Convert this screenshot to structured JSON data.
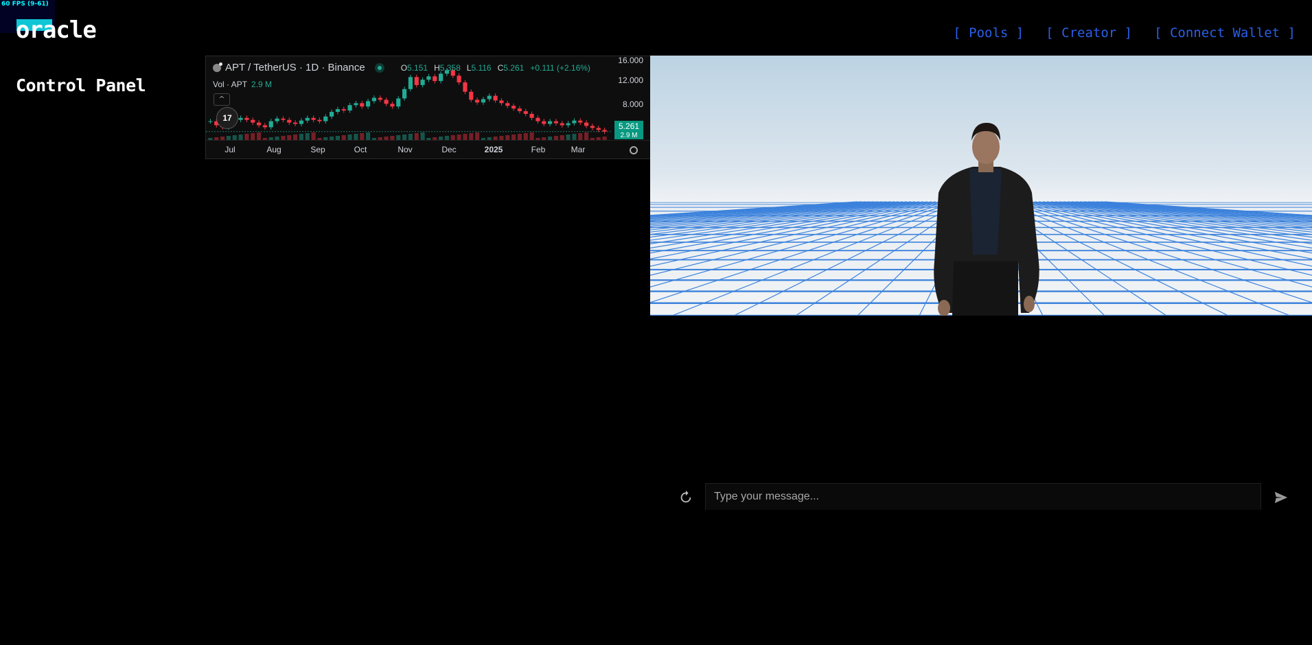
{
  "fps": {
    "label": "60 FPS (9-61)"
  },
  "header": {
    "logo": "oracle",
    "subtitle": "Control Panel",
    "nav": [
      "[ Pools ]",
      "[ Creator ]",
      "[ Connect Wallet ]"
    ]
  },
  "widget": {
    "symbol": "APT / TetherUS · 1D · Binance",
    "ohlc": [
      {
        "k": "O",
        "v": "5.151"
      },
      {
        "k": "H",
        "v": "5.358"
      },
      {
        "k": "L",
        "v": "5.116"
      },
      {
        "k": "C",
        "v": "5.261"
      }
    ],
    "change": "+0.111 (+2.16%)",
    "volume_label": "Vol · APT",
    "volume_value": "2.9 M",
    "price_tag": "5.261",
    "volume_tag": "2.9 M",
    "logo_text": "17",
    "collapse_icon": "chevron-up-icon",
    "settings_icon": "gear-icon",
    "colors": {
      "up": "#22ab94",
      "down": "#f23645",
      "tag": "#089981"
    }
  },
  "chart_data": {
    "type": "candlestick",
    "title": "APT / TetherUS · 1D · Binance",
    "x_ticks": [
      "Jul",
      "Aug",
      "Sep",
      "Oct",
      "Nov",
      "Dec",
      "2025",
      "Feb",
      "Mar"
    ],
    "y_ticks": [
      "16.000",
      "12.000",
      "8.000"
    ],
    "ylim": [
      4,
      16.5
    ],
    "close": [
      6.8,
      6.2,
      5.9,
      6.5,
      7.0,
      7.3,
      7.0,
      6.6,
      6.2,
      5.9,
      6.8,
      7.2,
      7.0,
      6.6,
      6.4,
      6.9,
      7.3,
      7.0,
      6.8,
      7.5,
      8.2,
      8.6,
      8.4,
      9.2,
      9.5,
      9.0,
      9.8,
      10.3,
      10.0,
      9.4,
      9.0,
      10.2,
      11.6,
      13.4,
      12.2,
      13.0,
      13.5,
      12.8,
      13.9,
      14.4,
      13.6,
      12.6,
      11.2,
      10.0,
      9.6,
      10.1,
      10.6,
      9.9,
      9.5,
      9.1,
      8.7,
      8.3,
      7.9,
      7.3,
      6.8,
      6.4,
      6.8,
      6.5,
      6.2,
      6.5,
      6.9,
      6.6,
      6.1,
      5.8,
      5.5,
      5.26
    ]
  },
  "chat": {
    "placeholder": "Type your message...",
    "reset_icon": "refresh-icon",
    "send_icon": "send-icon"
  }
}
